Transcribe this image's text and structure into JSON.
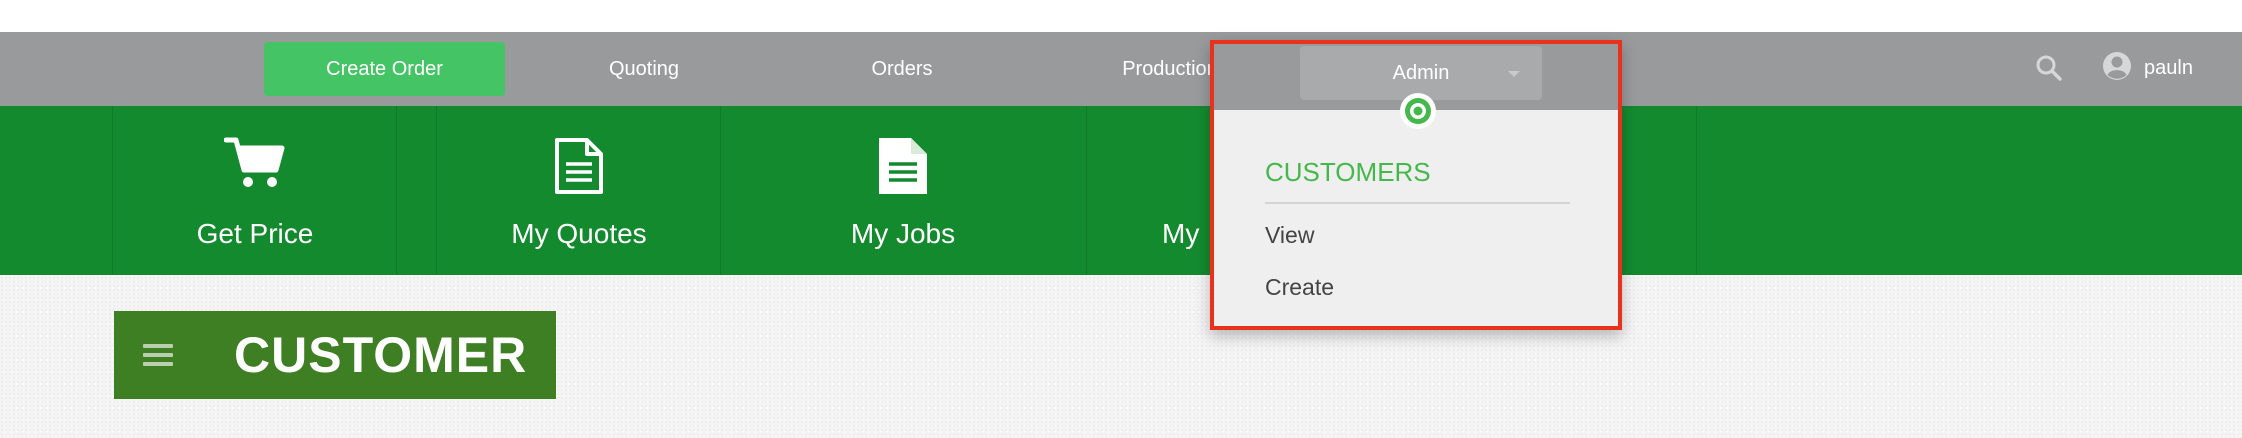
{
  "navbar": {
    "create_order": "Create Order",
    "quoting": "Quoting",
    "orders": "Orders",
    "production": "Production",
    "admin": "Admin",
    "user_name": "pauln"
  },
  "quickbar": {
    "get_price": "Get Price",
    "my_quotes": "My Quotes",
    "my_jobs": "My Jobs",
    "my_partial": "My"
  },
  "page": {
    "title": "CUSTOMER"
  },
  "dropdown": {
    "section_title": "CUSTOMERS",
    "items": [
      "View",
      "Create"
    ]
  },
  "icons": {
    "search": "search-icon",
    "user": "user-circle-icon",
    "cart": "cart-icon",
    "quote": "document-outline-icon",
    "jobs": "document-filled-icon",
    "menu": "hamburger-icon",
    "target": "target-icon"
  },
  "colors": {
    "nav_gray": "#999a9c",
    "primary_green": "#45c466",
    "quickbar_green": "#148a2f",
    "header_green": "#3f7f24",
    "highlight_red": "#e8321e",
    "section_green": "#45b84c"
  }
}
